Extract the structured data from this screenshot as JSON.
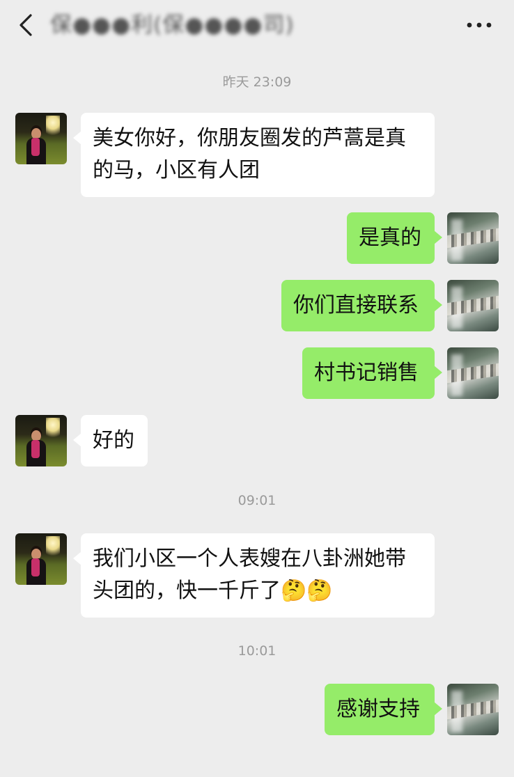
{
  "header": {
    "back_icon": "chevron-left-icon",
    "title": "保●●●利(保●●●●司)",
    "more_icon": "ellipsis-icon"
  },
  "timestamps": [
    "昨天 23:09",
    "09:01",
    "10:01"
  ],
  "messages": [
    {
      "side": "left",
      "text": "美女你好，你朋友圈发的芦蒿是真的马，小区有人团"
    },
    {
      "side": "right",
      "text": "是真的"
    },
    {
      "side": "right",
      "text": "你们直接联系"
    },
    {
      "side": "right",
      "text": "村书记销售"
    },
    {
      "side": "left",
      "text": "好的"
    },
    {
      "side": "left",
      "text": "我们小区一个人表嫂在八卦洲她带头团的，快一千斤了",
      "emojis": "🤔🤔"
    },
    {
      "side": "right",
      "text": "感谢支持"
    }
  ],
  "colors": {
    "background": "#ededed",
    "self_bubble": "#95ec69",
    "other_bubble": "#ffffff",
    "timestamp": "#9a9a9a"
  }
}
